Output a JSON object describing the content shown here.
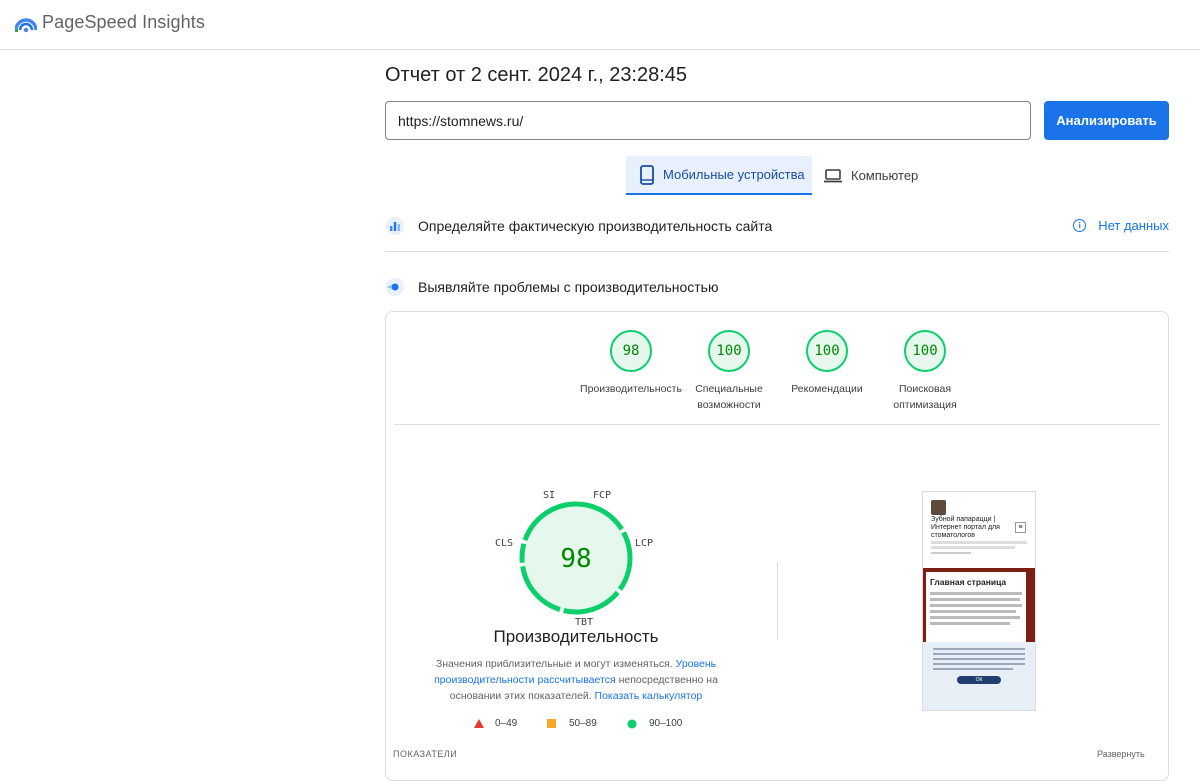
{
  "app": {
    "brand": "PageSpeed Insights"
  },
  "report": {
    "title": "Отчет от 2 сент. 2024 г., 23:28:45"
  },
  "search": {
    "value": "https://stomnews.ru/",
    "button_label": "Анализировать"
  },
  "tabs": [
    {
      "label": "Мобильные устройства",
      "active": true,
      "icon": "smartphone-icon"
    },
    {
      "label": "Компьютер",
      "active": false,
      "icon": "laptop-icon"
    }
  ],
  "field_data": {
    "heading": "Определяйте фактическую производительность сайта",
    "status": "Нет данных"
  },
  "lab_data": {
    "heading": "Выявляйте проблемы с производительностью"
  },
  "scores": [
    {
      "value": "98",
      "label": "Производительность"
    },
    {
      "value": "100",
      "label": "Специальные возможности"
    },
    {
      "value": "100",
      "label": "Рекомендации"
    },
    {
      "value": "100",
      "label": "Поисковая оптимизация"
    }
  ],
  "performance": {
    "score": "98",
    "title": "Производительность",
    "metric_labels": {
      "si": "SI",
      "fcp": "FCP",
      "lcp": "LCP",
      "tbt": "TBT",
      "cls": "CLS"
    },
    "note_prefix": "Значения приблизительные и могут изменяться.",
    "note_link1": "Уровень производительности рассчитывается",
    "note_middle": "непосредственно на основании этих показателей.",
    "note_link2": "Показать калькулятор"
  },
  "legend": [
    {
      "range": "0–49",
      "color": "#e53935",
      "shape": "triangle"
    },
    {
      "range": "50–89",
      "color": "#f9a825",
      "shape": "square"
    },
    {
      "range": "90–100",
      "color": "#0cce6b",
      "shape": "circle"
    }
  ],
  "screenshot": {
    "site_title": "Зубной папарацци | Интернет портал для стоматологов",
    "page_heading": "Главная страница",
    "cookie_button": "ОК"
  },
  "footer": {
    "left": "ПОКАЗАТЕЛИ",
    "right": "Развернуть"
  },
  "colors": {
    "accent": "#1a73e8",
    "good": "#0cce6b",
    "good_text": "#008800"
  }
}
